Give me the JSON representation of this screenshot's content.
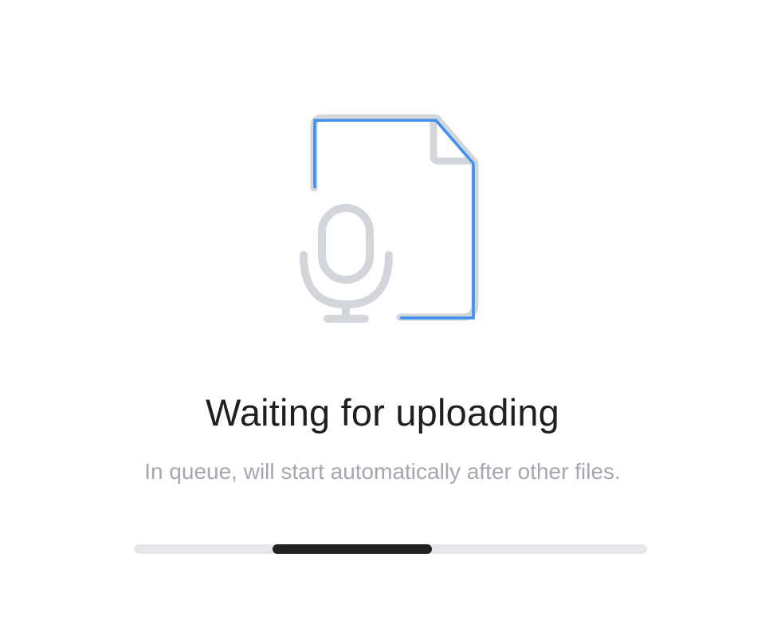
{
  "status": {
    "title": "Waiting for uploading",
    "message": "In queue, will start automatically after other files."
  },
  "illustration": {
    "icon": "audio-file-icon",
    "secondary_icon": "microphone-icon",
    "icon_color": "#d2d5da",
    "accent_color": "#3d8ff0"
  },
  "progress": {
    "type": "indeterminate",
    "segment_start": 0.27,
    "segment_fraction": 0.31,
    "track_color": "#e5e7ea",
    "bar_color": "#222222"
  }
}
